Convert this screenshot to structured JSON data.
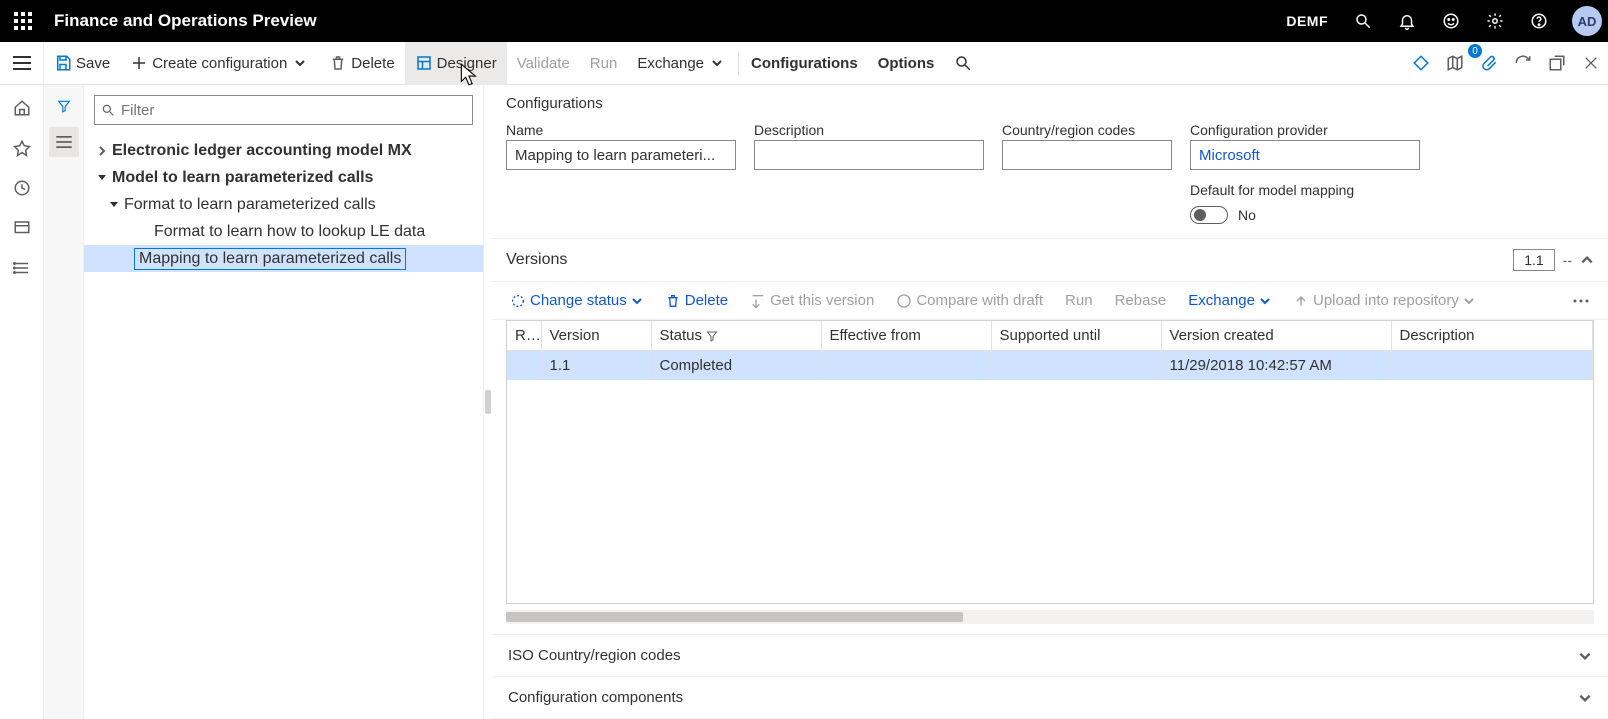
{
  "titlebar": {
    "app_title": "Finance and Operations Preview",
    "environment": "DEMF",
    "avatar_initials": "AD"
  },
  "commandbar": {
    "save": "Save",
    "create": "Create configuration",
    "delete": "Delete",
    "designer": "Designer",
    "validate": "Validate",
    "run": "Run",
    "exchange": "Exchange",
    "configurations": "Configurations",
    "options": "Options",
    "badge_count": "0"
  },
  "filter": {
    "placeholder": "Filter"
  },
  "tree": {
    "n0": "Electronic ledger accounting model MX",
    "n1": "Model to learn parameterized calls",
    "n2": "Format to learn parameterized calls",
    "n3": "Format to learn how to lookup LE data",
    "n4": "Mapping to learn parameterized calls"
  },
  "details": {
    "heading": "Configurations",
    "labels": {
      "name": "Name",
      "description": "Description",
      "country": "Country/region codes",
      "provider": "Configuration provider",
      "default_mm": "Default for model mapping"
    },
    "name_value": "Mapping to learn parameteri...",
    "provider_value": "Microsoft",
    "default_mm_value": "No"
  },
  "versions": {
    "title": "Versions",
    "chip": "1.1",
    "dash": "--",
    "toolbar": {
      "change_status": "Change status",
      "delete": "Delete",
      "get_version": "Get this version",
      "compare": "Compare with draft",
      "run": "Run",
      "rebase": "Rebase",
      "exchange": "Exchange",
      "upload": "Upload into repository"
    },
    "columns": {
      "r": "R...",
      "version": "Version",
      "status": "Status",
      "effective": "Effective from",
      "supported": "Supported until",
      "created": "Version created",
      "description": "Description"
    },
    "row": {
      "version": "1.1",
      "status": "Completed",
      "effective": "",
      "supported": "",
      "created": "11/29/2018 10:42:57 AM",
      "description": ""
    }
  },
  "expanders": {
    "iso": "ISO Country/region codes",
    "components": "Configuration components"
  }
}
